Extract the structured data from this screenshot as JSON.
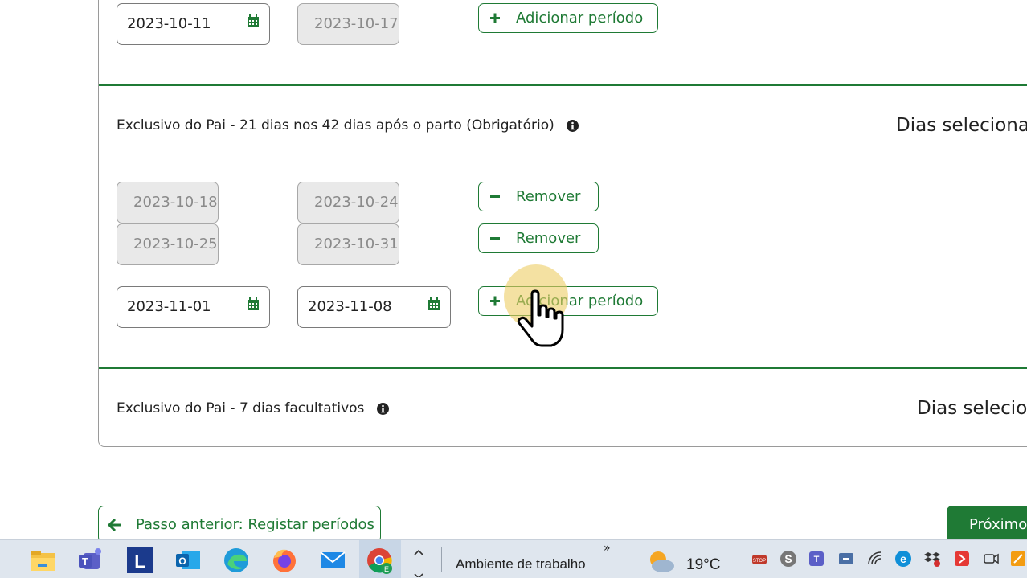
{
  "top_row": {
    "start_date": "2023-10-11",
    "end_date": "2023-10-17",
    "add_label": "Adicionar período"
  },
  "section_pai_21": {
    "title": "Exclusivo do Pai - 21 dias nos 42 dias após o parto (Obrigatório)",
    "dias_label": "Dias selecionad",
    "periods": [
      {
        "start": "2023-10-18",
        "end": "2023-10-24",
        "remove_label": "Remover"
      },
      {
        "start": "2023-10-25",
        "end": "2023-10-31",
        "remove_label": "Remover"
      }
    ],
    "new_start": "2023-11-01",
    "new_end": "2023-11-08",
    "add_label": "Adicionar período"
  },
  "section_pai_7": {
    "title": "Exclusivo do Pai - 7 dias facultativos",
    "dias_label": "Dias selecion"
  },
  "nav": {
    "prev_label": "Passo anterior: Registar períodos",
    "next_label": "Próximo"
  },
  "taskbar": {
    "desktop_label": "Ambiente de trabalho",
    "temperature": "19°C",
    "icons": [
      "file-explorer-icon",
      "teams-icon",
      "l-app-icon",
      "outlook-icon",
      "edge-icon",
      "firefox-icon",
      "mail-icon",
      "chrome-icon"
    ]
  },
  "colors": {
    "accent": "#1f7a35",
    "disabled_bg": "#e9e9e9"
  }
}
